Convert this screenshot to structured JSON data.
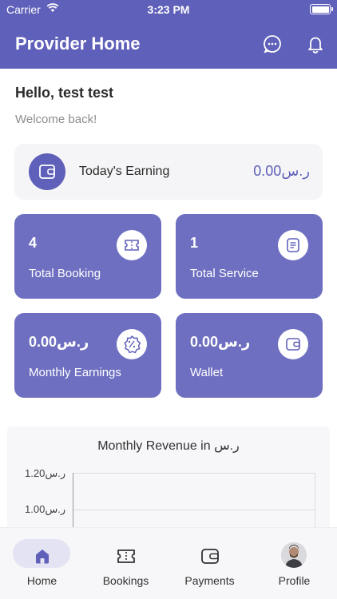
{
  "status_bar": {
    "carrier": "Carrier",
    "time": "3:23 PM"
  },
  "header": {
    "title": "Provider Home"
  },
  "greeting": {
    "hello": "Hello, test test",
    "welcome": "Welcome back!"
  },
  "earning": {
    "label": "Today's Earning",
    "value": "0.00ر.س"
  },
  "cards": [
    {
      "value": "4",
      "label": "Total Booking",
      "icon": "ticket-icon"
    },
    {
      "value": "1",
      "label": "Total Service",
      "icon": "document-icon"
    },
    {
      "value": "0.00ر.س",
      "label": "Monthly Earnings",
      "icon": "badge-percent-icon"
    },
    {
      "value": "0.00ر.س",
      "label": "Wallet",
      "icon": "wallet-icon"
    }
  ],
  "chart_data": {
    "type": "line",
    "title": "Monthly Revenue in ر.س",
    "y_ticks": [
      "1.20ر.س",
      "1.00ر.س"
    ],
    "series": [],
    "grid": true
  },
  "tabs": [
    {
      "label": "Home",
      "icon": "home-icon",
      "active": true
    },
    {
      "label": "Bookings",
      "icon": "ticket-icon",
      "active": false
    },
    {
      "label": "Payments",
      "icon": "wallet-icon",
      "active": false
    },
    {
      "label": "Profile",
      "icon": "avatar",
      "active": false
    }
  ],
  "colors": {
    "primary": "#5f60b9",
    "card": "#6e6fc0"
  }
}
